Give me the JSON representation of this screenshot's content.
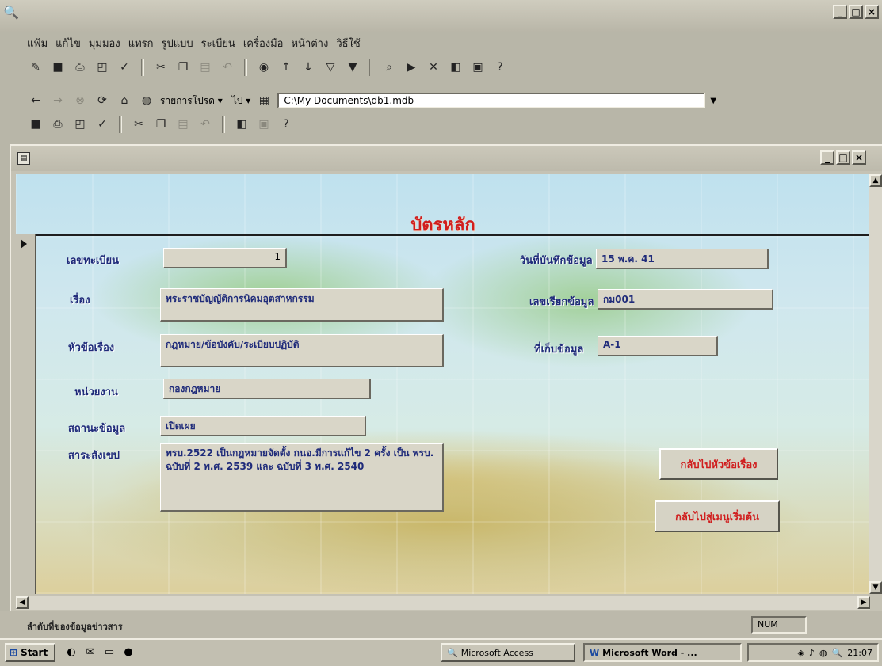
{
  "menu": [
    "แฟ้ม",
    "แก้ไข",
    "มุมมอง",
    "แทรก",
    "รูปแบบ",
    "ระเบียน",
    "เครื่องมือ",
    "หน้าต่าง",
    "วิธีใช้"
  ],
  "web_toolbar": {
    "favorites_label": "รายการโปรด",
    "go_label": "ไป",
    "address": "C:\\My Documents\\db1.mdb"
  },
  "form": {
    "title": "บัตรหลัก",
    "fields": {
      "record_no": {
        "label": "เลขทะเบียน",
        "value": "1"
      },
      "subject": {
        "label": "เรื่อง",
        "value": "พระราชบัญญัติการนิคมอุตสาหกรรม"
      },
      "topic": {
        "label": "หัวข้อเรื่อง",
        "value": "กฎหมาย/ข้อบังคับ/ระเบียบปฏิบัติ"
      },
      "agency": {
        "label": "หน่วยงาน",
        "value": "กองกฎหมาย"
      },
      "status": {
        "label": "สถานะข้อมูล",
        "value": "เปิดเผย"
      },
      "summary": {
        "label": "สาระสังเขป",
        "value": "พรบ.2522 เป็นกฎหมายจัดตั้ง กนอ.มีการแก้ไข 2 ครั้ง เป็น พรบ. ฉบับที่ 2 พ.ศ. 2539 และ ฉบับที่ 3 พ.ศ. 2540"
      },
      "record_date": {
        "label": "วันที่บันทึกข้อมูล",
        "value": "15 พ.ค. 41"
      },
      "retrieval_code": {
        "label": "เลขเรียกข้อมูล",
        "value": "กม001"
      },
      "storage": {
        "label": "ที่เก็บข้อมูล",
        "value": "A-1"
      }
    },
    "buttons": {
      "back_to_topics": "กลับไปหัวข้อเรื่อง",
      "back_to_main": "กลับไปสู่เมนูเริ่มต้น"
    }
  },
  "status_bar": {
    "text": "ลำดับที่ของข้อมูลข่าวสาร",
    "indicator": "NUM"
  },
  "taskbar": {
    "start": "Start",
    "tasks": [
      "Microsoft Access",
      "Microsoft Word - ..."
    ],
    "clock": "21:07"
  },
  "colors": {
    "label_blue": "#1f2b7a",
    "title_red": "#d01e1e",
    "window_gray": "#c5c2b4"
  }
}
